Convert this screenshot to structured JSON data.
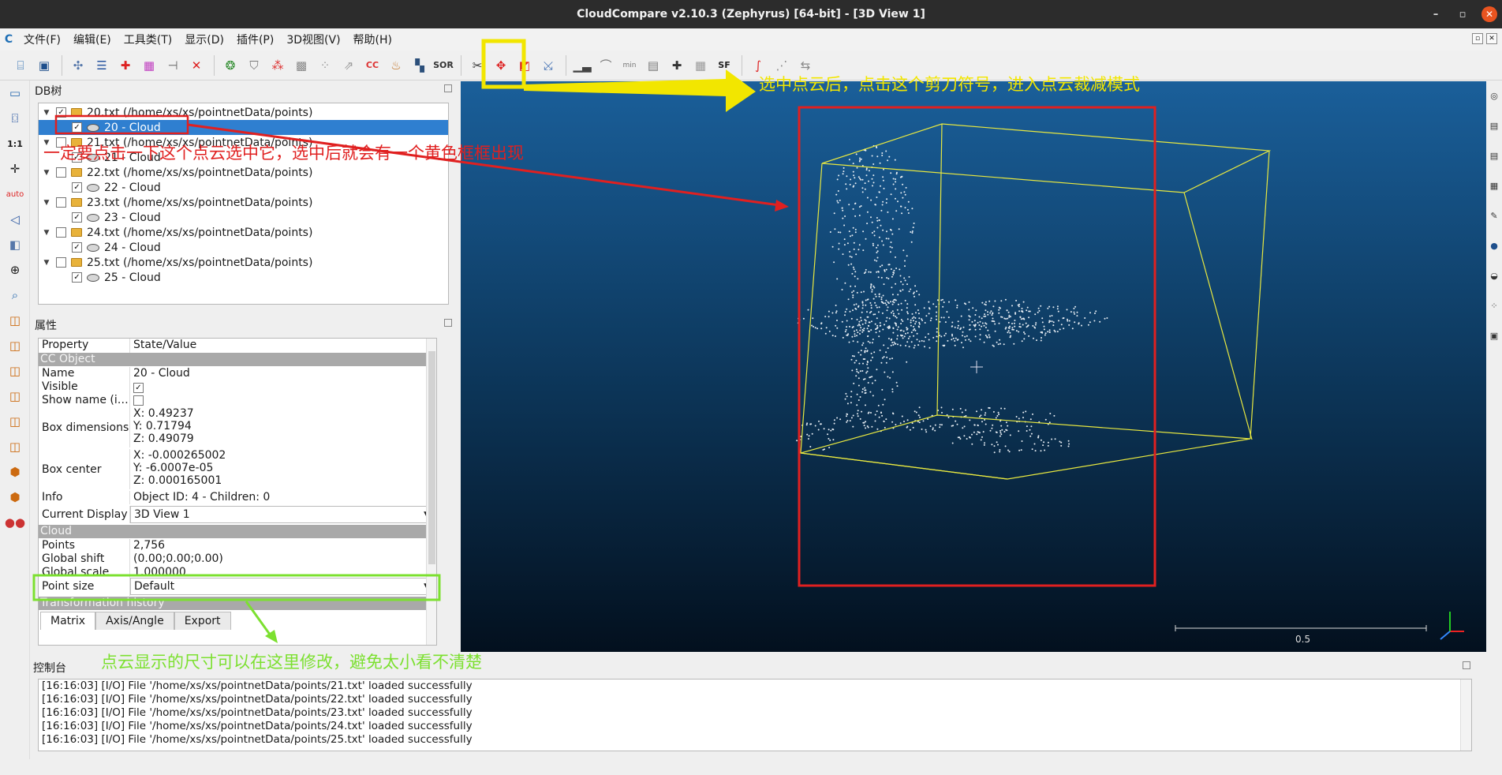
{
  "window": {
    "title": "CloudCompare v2.10.3 (Zephyrus) [64-bit] - [3D View 1]",
    "minimize": "–",
    "restore": "▫",
    "close": "✕"
  },
  "menu": [
    "文件(F)",
    "编辑(E)",
    "工具类(T)",
    "显示(D)",
    "插件(P)",
    "3D视图(V)",
    "帮助(H)"
  ],
  "app_logo": "C",
  "db_tree": {
    "title": "DB树",
    "items": [
      {
        "level": 0,
        "label": "20.txt (/home/xs/xs/pointnetData/points)",
        "checked": true
      },
      {
        "level": 1,
        "label": "20 - Cloud",
        "checked": true,
        "selected": true
      },
      {
        "level": 0,
        "label": "21.txt (/home/xs/xs/pointnetData/points)",
        "checked": false
      },
      {
        "level": 1,
        "label": "21 - Cloud",
        "checked": true
      },
      {
        "level": 0,
        "label": "22.txt (/home/xs/xs/pointnetData/points)",
        "checked": false
      },
      {
        "level": 1,
        "label": "22 - Cloud",
        "checked": true
      },
      {
        "level": 0,
        "label": "23.txt (/home/xs/xs/pointnetData/points)",
        "checked": false
      },
      {
        "level": 1,
        "label": "23 - Cloud",
        "checked": true
      },
      {
        "level": 0,
        "label": "24.txt (/home/xs/xs/pointnetData/points)",
        "checked": false
      },
      {
        "level": 1,
        "label": "24 - Cloud",
        "checked": true
      },
      {
        "level": 0,
        "label": "25.txt (/home/xs/xs/pointnetData/points)",
        "checked": false
      },
      {
        "level": 1,
        "label": "25 - Cloud",
        "checked": true
      }
    ]
  },
  "properties": {
    "title": "属性",
    "col_property": "Property",
    "col_value": "State/Value",
    "section_cc": "CC Object",
    "name_k": "Name",
    "name_v": "20 - Cloud",
    "visible_k": "Visible",
    "showname_k": "Show name (i…",
    "boxdim_k": "Box dimensions",
    "boxdim_x": "X: 0.49237",
    "boxdim_y": "Y: 0.71794",
    "boxdim_z": "Z: 0.49079",
    "boxcenter_k": "Box center",
    "boxcenter_x": "X: -0.000265002",
    "boxcenter_y": "Y: -6.0007e-05",
    "boxcenter_z": "Z: 0.000165001",
    "info_k": "Info",
    "info_v": "Object ID: 4 - Children: 0",
    "display_k": "Current Display",
    "display_v": "3D View 1",
    "section_cloud": "Cloud",
    "points_k": "Points",
    "points_v": "2,756",
    "shift_k": "Global shift",
    "shift_v": "(0.00;0.00;0.00)",
    "scale_k": "Global scale",
    "scale_v": "1.000000",
    "pointsize_k": "Point size",
    "pointsize_v": "Default",
    "section_transform": "Transformation history",
    "tabs": [
      "Matrix",
      "Axis/Angle",
      "Export"
    ]
  },
  "view3d": {
    "scale_label": "0.5"
  },
  "console": {
    "title": "控制台",
    "lines": [
      "[16:16:03] [I/O] File '/home/xs/xs/pointnetData/points/21.txt' loaded successfully",
      "[16:16:03] [I/O] File '/home/xs/xs/pointnetData/points/22.txt' loaded successfully",
      "[16:16:03] [I/O] File '/home/xs/xs/pointnetData/points/23.txt' loaded successfully",
      "[16:16:03] [I/O] File '/home/xs/xs/pointnetData/points/24.txt' loaded successfully",
      "[16:16:03] [I/O] File '/home/xs/xs/pointnetData/points/25.txt' loaded successfully"
    ]
  },
  "annotations": {
    "yellow": "选中点云后，点击这个剪刀符号，进入点云裁减模式",
    "red": "一定要点击一下这个点云选中它，选中后就会有一个黄色框框出现",
    "green": "点云显示的尺寸可以在这里修改，避免太小看不清楚"
  },
  "colors": {
    "annotation_yellow": "#f2e600",
    "annotation_red": "#e02020",
    "annotation_green": "#7ce030",
    "selection": "#2f7fd0"
  }
}
